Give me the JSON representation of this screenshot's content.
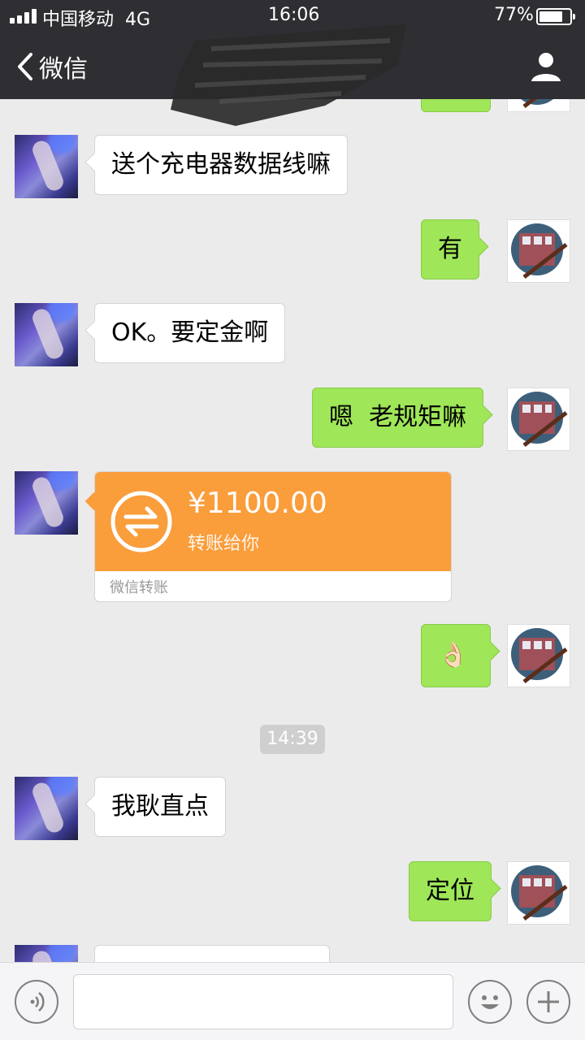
{
  "status_bar": {
    "carrier": "中国移动",
    "network": "4G",
    "time": "16:06",
    "battery_percent": "77%",
    "battery_level": 0.77
  },
  "nav": {
    "back_label": "微信",
    "back_icon": "chevron-left-icon",
    "profile_icon": "person-icon"
  },
  "messages": [
    {
      "side": "in",
      "text": "送个充电器数据线嘛"
    },
    {
      "side": "out",
      "text": "有"
    },
    {
      "side": "in",
      "text": "OK。要定金啊"
    },
    {
      "side": "out",
      "text": "嗯  老规矩嘛"
    },
    {
      "side": "in",
      "type": "transfer",
      "amount": "¥1100.00",
      "subtitle": "转账给你",
      "footer": "微信转账"
    },
    {
      "side": "out",
      "text": "👌🏻"
    },
    {
      "type": "timestamp",
      "text": "14:39"
    },
    {
      "side": "in",
      "text": "我耿直点"
    },
    {
      "side": "out",
      "text": "定位"
    }
  ],
  "input_bar": {
    "voice_icon": "voice-icon",
    "emoji_icon": "emoji-icon",
    "plus_icon": "plus-icon",
    "text_value": ""
  },
  "colors": {
    "nav_bg": "#2e2e33",
    "chat_bg": "#ebebeb",
    "outgoing_bubble": "#9fe658",
    "incoming_bubble": "#ffffff",
    "transfer_orange": "#fa9d3b"
  }
}
